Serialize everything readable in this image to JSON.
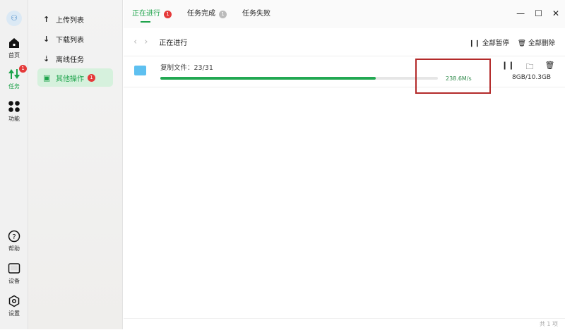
{
  "rail": {
    "items": [
      {
        "label": "首页"
      },
      {
        "label": "任务",
        "badge": "1"
      },
      {
        "label": "功能"
      }
    ],
    "bottom": [
      {
        "label": "帮助"
      },
      {
        "label": "设备"
      },
      {
        "label": "设置"
      }
    ]
  },
  "sidebar": {
    "items": [
      {
        "label": "上传列表",
        "icon": "↑"
      },
      {
        "label": "下载列表",
        "icon": "↓"
      },
      {
        "label": "离线任务",
        "icon": "⇣"
      },
      {
        "label": "其他操作",
        "icon": "▣",
        "badge": "1"
      }
    ]
  },
  "tabs": [
    {
      "label": "正在进行",
      "badge": "1"
    },
    {
      "label": "任务完成",
      "badge": "1"
    },
    {
      "label": "任务失败"
    }
  ],
  "toolbar": {
    "title": "正在进行",
    "pause_all": "全部暂停",
    "delete_all": "全部删除"
  },
  "task": {
    "name": "复制文件：23/31",
    "progress": 0.776,
    "speed": "238.6M/s",
    "size": "8GB/10.3GB"
  },
  "footer": {
    "count": "共 1 项"
  },
  "colors": {
    "accent": "#1ea34b",
    "badge": "#e53a3a"
  }
}
